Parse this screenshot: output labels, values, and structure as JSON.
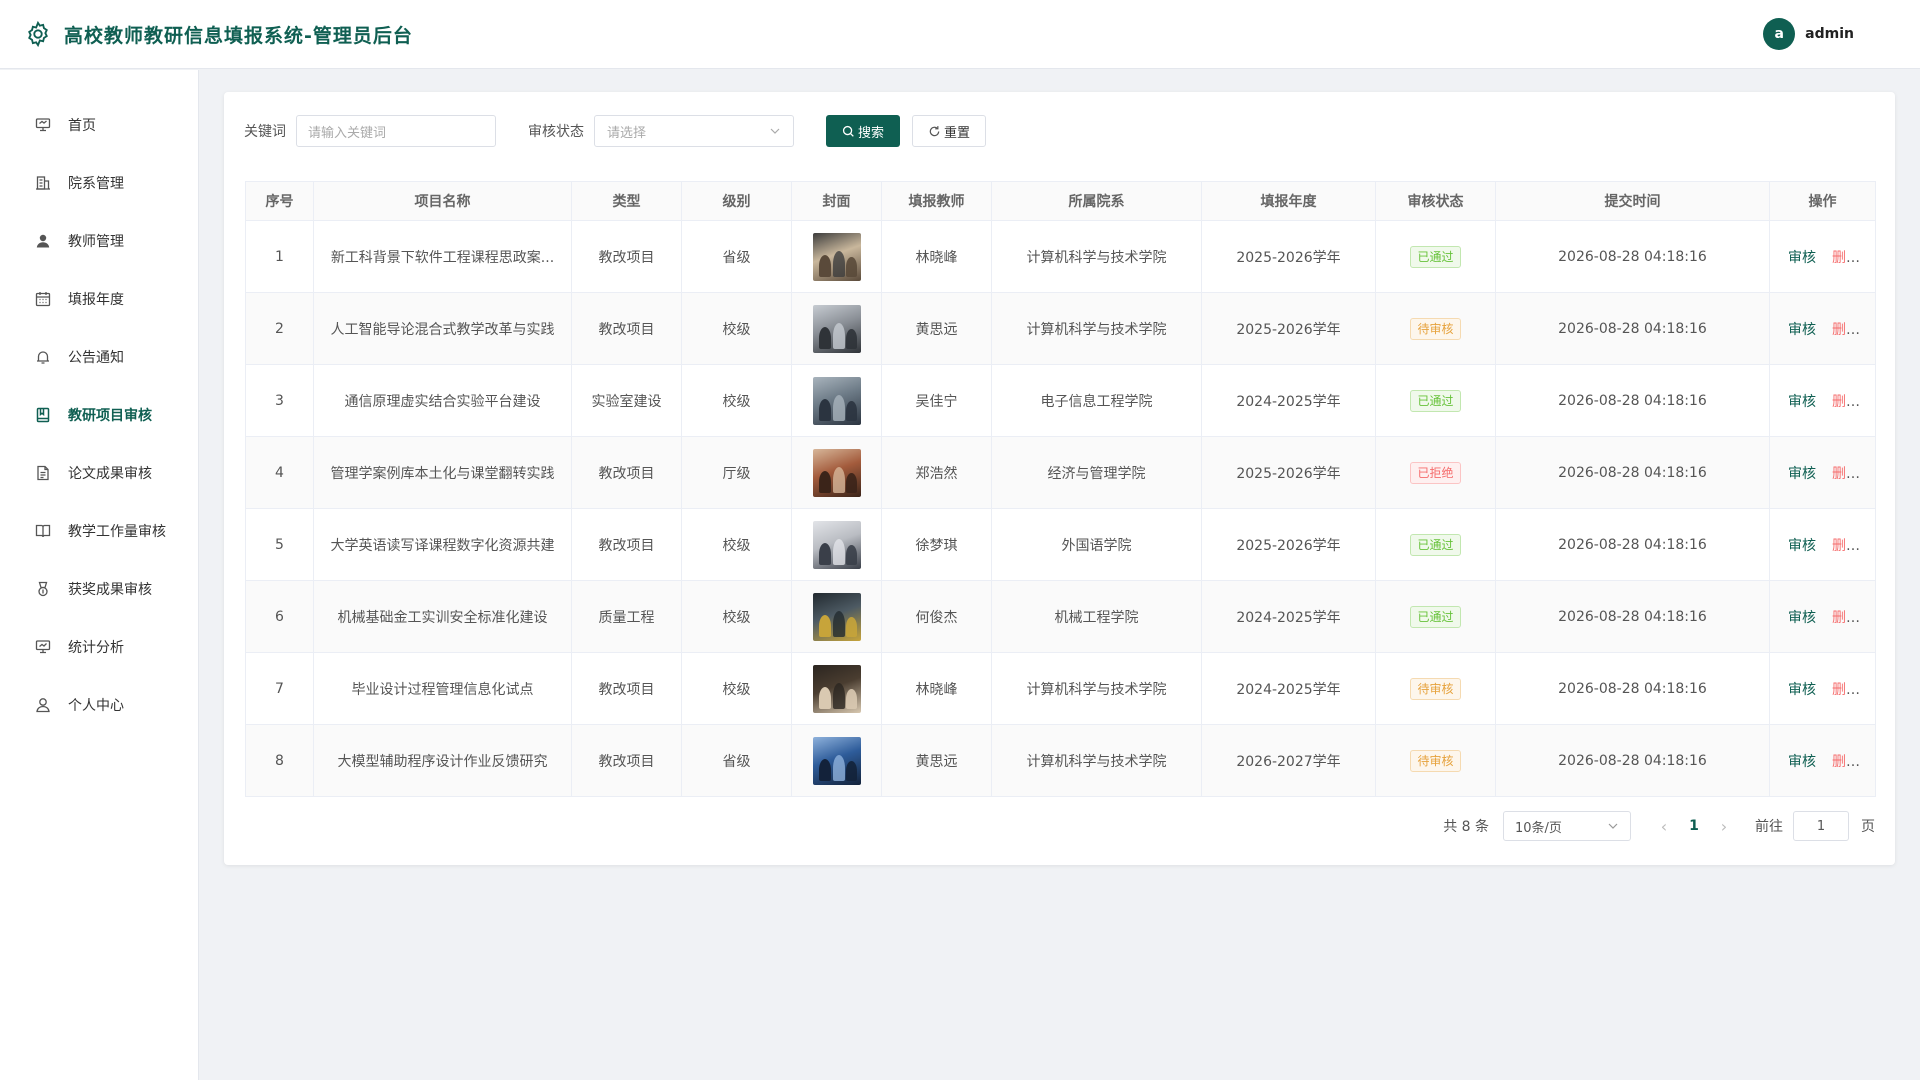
{
  "header": {
    "title": "高校教师教研信息填报系统-管理员后台",
    "user_initial": "a",
    "username": "admin"
  },
  "colors": {
    "brand": "#0f5f52",
    "success": "#67c23a",
    "warning": "#e6a23c",
    "danger": "#f56c6c"
  },
  "sidebar": {
    "items": [
      {
        "label": "首页",
        "icon": "home-icon",
        "active": false
      },
      {
        "label": "院系管理",
        "icon": "building-icon",
        "active": false
      },
      {
        "label": "教师管理",
        "icon": "user-solid-icon",
        "active": false
      },
      {
        "label": "填报年度",
        "icon": "calendar-icon",
        "active": false
      },
      {
        "label": "公告通知",
        "icon": "bell-icon",
        "active": false
      },
      {
        "label": "教研项目审核",
        "icon": "notebook-icon",
        "active": true
      },
      {
        "label": "论文成果审核",
        "icon": "document-icon",
        "active": false
      },
      {
        "label": "教学工作量审核",
        "icon": "book-icon",
        "active": false
      },
      {
        "label": "获奖成果审核",
        "icon": "medal-icon",
        "active": false
      },
      {
        "label": "统计分析",
        "icon": "chart-icon",
        "active": false
      },
      {
        "label": "个人中心",
        "icon": "user-icon",
        "active": false
      }
    ]
  },
  "filter": {
    "keyword_label": "关键词",
    "keyword_placeholder": "请输入关键词",
    "status_label": "审核状态",
    "status_placeholder": "请选择",
    "search_button": "搜索",
    "reset_button": "重置"
  },
  "table": {
    "columns": [
      "序号",
      "项目名称",
      "类型",
      "级别",
      "封面",
      "填报教师",
      "所属院系",
      "填报年度",
      "审核状态",
      "提交时间",
      "操作"
    ],
    "audit_label": "审核",
    "delete_label": "删除",
    "rows": [
      {
        "index": "1",
        "name": "新工科背景下软件工程课程思政案...",
        "type": "教改项目",
        "level": "省级",
        "teacher": "林晓峰",
        "dept": "计算机科学与技术学院",
        "year": "2025-2026学年",
        "status": "已通过",
        "status_kind": "success",
        "time": "2026-08-28 04:18:16"
      },
      {
        "index": "2",
        "name": "人工智能导论混合式教学改革与实践",
        "type": "教改项目",
        "level": "校级",
        "teacher": "黄思远",
        "dept": "计算机科学与技术学院",
        "year": "2025-2026学年",
        "status": "待审核",
        "status_kind": "warning",
        "time": "2026-08-28 04:18:16"
      },
      {
        "index": "3",
        "name": "通信原理虚实结合实验平台建设",
        "type": "实验室建设",
        "level": "校级",
        "teacher": "吴佳宁",
        "dept": "电子信息工程学院",
        "year": "2024-2025学年",
        "status": "已通过",
        "status_kind": "success",
        "time": "2026-08-28 04:18:16"
      },
      {
        "index": "4",
        "name": "管理学案例库本土化与课堂翻转实践",
        "type": "教改项目",
        "level": "厅级",
        "teacher": "郑浩然",
        "dept": "经济与管理学院",
        "year": "2025-2026学年",
        "status": "已拒绝",
        "status_kind": "danger",
        "time": "2026-08-28 04:18:16"
      },
      {
        "index": "5",
        "name": "大学英语读写译课程数字化资源共建",
        "type": "教改项目",
        "level": "校级",
        "teacher": "徐梦琪",
        "dept": "外国语学院",
        "year": "2025-2026学年",
        "status": "已通过",
        "status_kind": "success",
        "time": "2026-08-28 04:18:16"
      },
      {
        "index": "6",
        "name": "机械基础金工实训安全标准化建设",
        "type": "质量工程",
        "level": "校级",
        "teacher": "何俊杰",
        "dept": "机械工程学院",
        "year": "2024-2025学年",
        "status": "已通过",
        "status_kind": "success",
        "time": "2026-08-28 04:18:16"
      },
      {
        "index": "7",
        "name": "毕业设计过程管理信息化试点",
        "type": "教改项目",
        "level": "校级",
        "teacher": "林晓峰",
        "dept": "计算机科学与技术学院",
        "year": "2024-2025学年",
        "status": "待审核",
        "status_kind": "warning",
        "time": "2026-08-28 04:18:16"
      },
      {
        "index": "8",
        "name": "大模型辅助程序设计作业反馈研究",
        "type": "教改项目",
        "level": "省级",
        "teacher": "黄思远",
        "dept": "计算机科学与技术学院",
        "year": "2026-2027学年",
        "status": "待审核",
        "status_kind": "warning",
        "time": "2026-08-28 04:18:16"
      }
    ]
  },
  "pagination": {
    "total_text": "共 8 条",
    "page_size": "10条/页",
    "current_page": "1",
    "goto_label": "前往",
    "goto_value": "1",
    "page_suffix": "页"
  }
}
